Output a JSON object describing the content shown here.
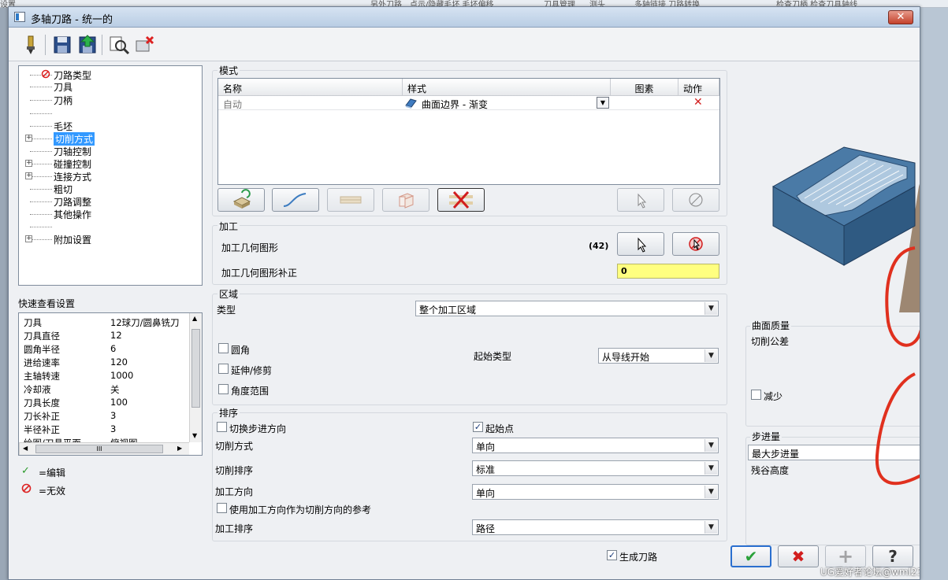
{
  "background": {
    "strip_items": [
      "设置",
      "另外刀路",
      "点示/隐藏毛坯 毛坯偏移",
      "刀具管理",
      "测头",
      "多轴链接 刀路转换",
      "检查刀柄 检查刀具轴线"
    ]
  },
  "window": {
    "title": "多轴刀路 - 统一的",
    "close_symbol": "✕"
  },
  "tree": {
    "items": [
      {
        "label": "刀路类型",
        "icon": "invalid-icon",
        "expand": false,
        "selected": false
      },
      {
        "label": "刀具",
        "expand": false,
        "selected": false
      },
      {
        "label": "刀柄",
        "expand": false,
        "selected": false
      },
      {
        "label": "",
        "expand": false,
        "selected": false
      },
      {
        "label": "毛坯",
        "expand": false,
        "selected": false
      },
      {
        "label": "切削方式",
        "expand": true,
        "selected": true
      },
      {
        "label": "刀轴控制",
        "expand": false,
        "selected": false
      },
      {
        "label": "碰撞控制",
        "expand": true,
        "selected": false
      },
      {
        "label": "连接方式",
        "expand": true,
        "selected": false
      },
      {
        "label": "粗切",
        "expand": false,
        "selected": false
      },
      {
        "label": "刀路调整",
        "expand": false,
        "selected": false
      },
      {
        "label": "其他操作",
        "expand": false,
        "selected": false
      },
      {
        "label": "",
        "expand": false,
        "selected": false
      },
      {
        "label": "附加设置",
        "expand": true,
        "selected": false
      }
    ]
  },
  "quickview": {
    "title": "快速查看设置",
    "rows": [
      {
        "k": "刀具",
        "v": "12球刀/圆鼻铣刀"
      },
      {
        "k": "刀具直径",
        "v": "12"
      },
      {
        "k": "圆角半径",
        "v": "6"
      },
      {
        "k": "进给速率",
        "v": "120"
      },
      {
        "k": "主轴转速",
        "v": "1000"
      },
      {
        "k": "冷却液",
        "v": "关"
      },
      {
        "k": "刀具长度",
        "v": "100"
      },
      {
        "k": "刀长补正",
        "v": "3"
      },
      {
        "k": "半径补正",
        "v": "3"
      },
      {
        "k": "绘图/刀具平面",
        "v": "俯视图"
      }
    ],
    "scroll_grip": "III"
  },
  "legend": {
    "edit": "=编辑",
    "invalid": "=无效"
  },
  "mode": {
    "title": "模式",
    "headers": {
      "name": "名称",
      "style": "样式",
      "figure": "图素",
      "action": "动作"
    },
    "row": {
      "name": "自动",
      "style": "曲面边界 - 渐变",
      "action_symbol": "✕"
    }
  },
  "machining": {
    "title": "加工",
    "geometry_label": "加工几何图形",
    "geometry_count": "(42)",
    "offset_label": "加工几何图形补正",
    "offset_value": "0"
  },
  "region": {
    "title": "区域",
    "type_label": "类型",
    "type_value": "整个加工区域",
    "fillet": "圆角",
    "extend": "延伸/修剪",
    "angle": "角度范围",
    "start_type_label": "起始类型",
    "start_type_value": "从导线开始"
  },
  "sorting": {
    "title": "排序",
    "switch_dir": "切换步进方向",
    "start_point": "起始点",
    "cut_method_label": "切削方式",
    "cut_method_value": "单向",
    "cut_order_label": "切削排序",
    "cut_order_value": "标准",
    "mach_dir_label": "加工方向",
    "mach_dir_value": "单向",
    "use_dir": "使用加工方向作为切削方向的参考",
    "mach_order_label": "加工排序",
    "mach_order_value": "路径"
  },
  "quality": {
    "title": "曲面质量",
    "tolerance": "切削公差",
    "reduce": "减少"
  },
  "stepover": {
    "title": "步进量",
    "max_step": "最大步进量",
    "scallop": "残谷高度"
  },
  "footer": {
    "generate": "生成刀路",
    "ok_symbol": "✔",
    "cancel_symbol": "✖",
    "add_symbol": "+",
    "help_symbol": "?",
    "watermark": "UG爱好者论坛@wml23123"
  },
  "colors": {
    "selection": "#3399ff",
    "yellow_field": "#ffff80",
    "red_mark": "#e0301e",
    "part_blue": "#3f6d96"
  }
}
